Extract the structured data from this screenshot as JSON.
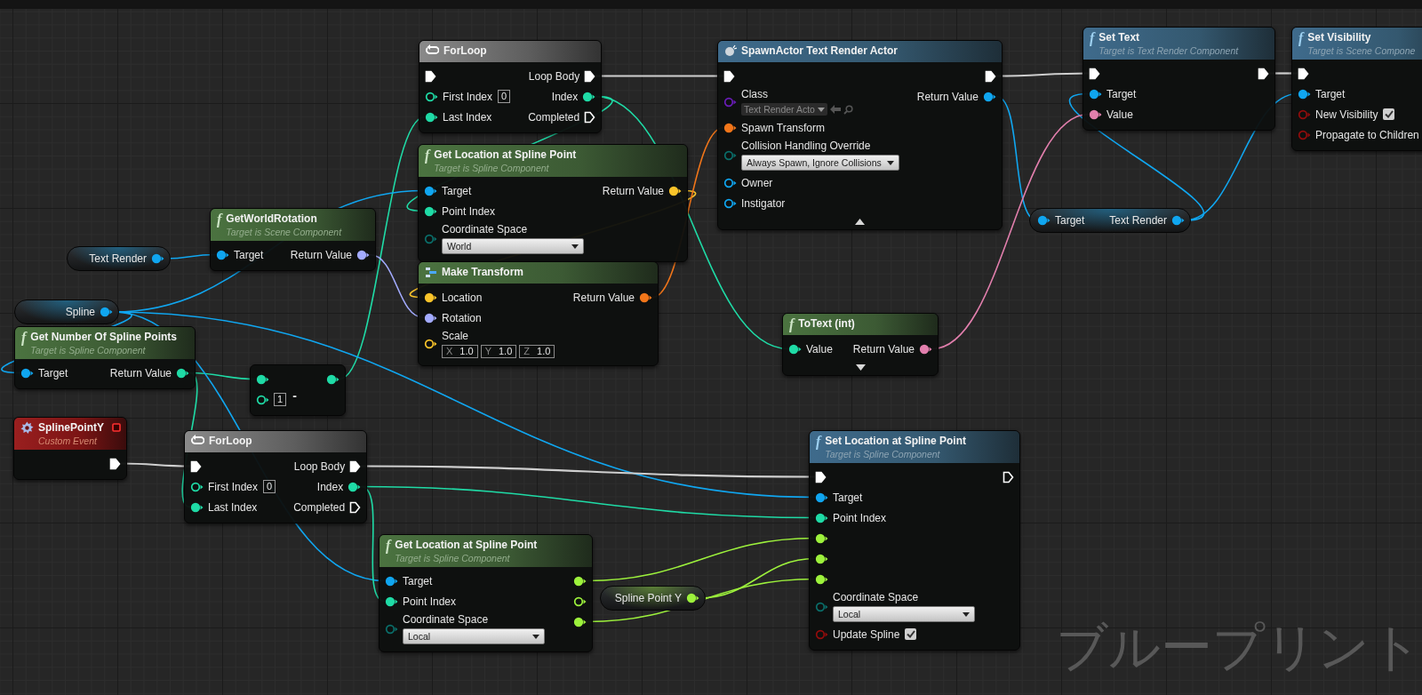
{
  "graph": {
    "nodes": [
      {
        "kind": "macro",
        "title": "ForLoop",
        "inputs": [
          {
            "kind": "exec",
            "color": "#ffffff",
            "connected": true
          },
          {
            "kind": "data",
            "color": "#1fdba6",
            "connected": false,
            "label": "First Index",
            "widget": {
              "kind": "number",
              "value": "0"
            }
          },
          {
            "kind": "data",
            "color": "#1fdba6",
            "connected": true,
            "label": "Last Index"
          }
        ],
        "outputs": [
          {
            "kind": "exec",
            "color": "#ffffff",
            "connected": true,
            "label": "Loop Body"
          },
          {
            "kind": "data",
            "color": "#1fdba6",
            "connected": true,
            "label": "Index"
          },
          {
            "kind": "exec",
            "color": "#ffffff",
            "connected": false,
            "label": "Completed"
          }
        ]
      },
      {
        "kind": "spawn",
        "title": "SpawnActor Text Render Actor",
        "inputs": [
          {
            "kind": "exec",
            "color": "#ffffff",
            "connected": true
          },
          {
            "kind": "data",
            "color": "#6a1cb8",
            "connected": false,
            "label": "Class",
            "widget": {
              "kind": "class_picker",
              "value": "Text Render Acto"
            }
          },
          {
            "kind": "data",
            "color": "#f2761a",
            "connected": true,
            "label": "Spawn Transform"
          },
          {
            "kind": "data",
            "color": "#0a6e6a",
            "connected": false,
            "label": "Collision Handling Override",
            "widget": {
              "kind": "dropdown",
              "value": "Always Spawn, Ignore Collisions"
            }
          },
          {
            "kind": "data",
            "color": "#10a6f0",
            "connected": false,
            "label": "Owner"
          },
          {
            "kind": "data",
            "color": "#10a6f0",
            "connected": false,
            "label": "Instigator"
          }
        ],
        "outputs": [
          {
            "kind": "exec",
            "color": "#ffffff",
            "connected": true
          },
          {
            "kind": "data",
            "color": "#10a6f0",
            "connected": true,
            "label": "Return Value"
          }
        ],
        "advanced_expanded": true
      },
      {
        "kind": "impure",
        "glyph": "f",
        "title": "Set Text",
        "subtitle": "Target is Text Render Component",
        "inputs": [
          {
            "kind": "exec",
            "color": "#ffffff",
            "connected": true
          },
          {
            "kind": "data",
            "color": "#10a6f0",
            "connected": true,
            "label": "Target"
          },
          {
            "kind": "data",
            "color": "#e27fad",
            "connected": true,
            "label": "Value"
          }
        ],
        "outputs": [
          {
            "kind": "exec",
            "color": "#ffffff",
            "connected": true
          }
        ]
      },
      {
        "kind": "impure",
        "glyph": "f",
        "title": "Set Visibility",
        "subtitle": "Target is Scene Compone",
        "inputs": [
          {
            "kind": "exec",
            "color": "#ffffff",
            "connected": true
          },
          {
            "kind": "data",
            "color": "#10a6f0",
            "connected": true,
            "label": "Target"
          },
          {
            "kind": "data",
            "color": "#930c0c",
            "connected": false,
            "label": "New Visibility",
            "widget": {
              "kind": "checkbox",
              "checked": true
            }
          },
          {
            "kind": "data",
            "color": "#930c0c",
            "connected": false,
            "label": "Propagate to Children"
          }
        ]
      },
      {
        "kind": "variable",
        "outputs": [
          {
            "kind": "data",
            "color": "#10a6f0",
            "connected": true,
            "label": "Text Render"
          }
        ]
      },
      {
        "kind": "pure",
        "glyph": "f",
        "title": "GetWorldRotation",
        "subtitle": "Target is Scene Component",
        "inputs": [
          {
            "kind": "data",
            "color": "#10a6f0",
            "connected": true,
            "label": "Target"
          }
        ],
        "outputs": [
          {
            "kind": "data",
            "color": "#a3abff",
            "connected": true,
            "label": "Return Value"
          }
        ]
      },
      {
        "kind": "pure",
        "glyph": "f",
        "title": "Get Location at Spline Point",
        "subtitle": "Target is Spline Component",
        "inputs": [
          {
            "kind": "data",
            "color": "#10a6f0",
            "connected": true,
            "label": "Target"
          },
          {
            "kind": "data",
            "color": "#1fdba6",
            "connected": true,
            "label": "Point Index"
          },
          {
            "kind": "data",
            "color": "#0a6e6a",
            "connected": false,
            "label": "Coordinate Space",
            "widget": {
              "kind": "dropdown",
              "value": "World"
            }
          }
        ],
        "outputs": [
          {
            "kind": "data",
            "color": "#fac42a",
            "connected": true,
            "label": "Return Value"
          }
        ]
      },
      {
        "kind": "variable",
        "outputs": [
          {
            "kind": "data",
            "color": "#10a6f0",
            "connected": true,
            "label": "Spline"
          }
        ]
      },
      {
        "kind": "struct",
        "title": "Make Transform",
        "inputs": [
          {
            "kind": "data",
            "color": "#fac42a",
            "connected": true,
            "label": "Location"
          },
          {
            "kind": "data",
            "color": "#a3abff",
            "connected": true,
            "label": "Rotation"
          },
          {
            "kind": "data",
            "color": "#fac42a",
            "connected": false,
            "label": "Scale",
            "widget": {
              "kind": "vector",
              "components": [
                {
                  "axis": "X",
                  "value": "1.0"
                },
                {
                  "axis": "Y",
                  "value": "1.0"
                },
                {
                  "axis": "Z",
                  "value": "1.0"
                }
              ]
            }
          }
        ],
        "outputs": [
          {
            "kind": "data",
            "color": "#f2761a",
            "connected": true,
            "label": "Return Value"
          }
        ]
      },
      {
        "kind": "pure",
        "glyph": "f",
        "title": "Get Number Of Spline Points",
        "subtitle": "Target is Spline Component",
        "inputs": [
          {
            "kind": "data",
            "color": "#10a6f0",
            "connected": true,
            "label": "Target"
          }
        ],
        "outputs": [
          {
            "kind": "data",
            "color": "#1fdba6",
            "connected": true,
            "label": "Return Value"
          }
        ]
      },
      {
        "kind": "operator",
        "title": "-",
        "inputs": [
          {
            "kind": "data",
            "color": "#1fdba6",
            "connected": true
          },
          {
            "kind": "data",
            "color": "#1fdba6",
            "connected": false,
            "widget": {
              "kind": "number",
              "value": "1"
            }
          }
        ],
        "outputs": [
          {
            "kind": "data",
            "color": "#1fdba6",
            "connected": true
          }
        ]
      },
      {
        "kind": "event",
        "title": "SplinePointY",
        "subtitle": "Custom Event",
        "outputs": [
          {
            "kind": "exec",
            "color": "#ffffff",
            "connected": true
          }
        ]
      },
      {
        "kind": "macro",
        "title": "ForLoop",
        "inputs": [
          {
            "kind": "exec",
            "color": "#ffffff",
            "connected": true
          },
          {
            "kind": "data",
            "color": "#1fdba6",
            "connected": false,
            "label": "First Index",
            "widget": {
              "kind": "number",
              "value": "0"
            }
          },
          {
            "kind": "data",
            "color": "#1fdba6",
            "connected": true,
            "label": "Last Index"
          }
        ],
        "outputs": [
          {
            "kind": "exec",
            "color": "#ffffff",
            "connected": true,
            "label": "Loop Body"
          },
          {
            "kind": "data",
            "color": "#1fdba6",
            "connected": true,
            "label": "Index"
          },
          {
            "kind": "exec",
            "color": "#ffffff",
            "connected": false,
            "label": "Completed"
          }
        ]
      },
      {
        "kind": "pure",
        "glyph": "f",
        "title": "Get Location at Spline Point",
        "subtitle": "Target is Spline Component",
        "inputs": [
          {
            "kind": "data",
            "color": "#10a6f0",
            "connected": true,
            "label": "Target"
          },
          {
            "kind": "data",
            "color": "#1fdba6",
            "connected": true,
            "label": "Point Index"
          },
          {
            "kind": "data",
            "color": "#0a6e6a",
            "connected": false,
            "label": "Coordinate Space",
            "widget": {
              "kind": "dropdown",
              "value": "Local"
            }
          }
        ],
        "outputs": [
          {
            "kind": "data",
            "color": "#9df23c",
            "connected": true
          },
          {
            "kind": "data",
            "color": "#9df23c",
            "connected": false
          },
          {
            "kind": "data",
            "color": "#9df23c",
            "connected": true
          }
        ]
      },
      {
        "kind": "variable",
        "outputs": [
          {
            "kind": "data",
            "color": "#9df23c",
            "connected": true,
            "label": "Spline Point Y"
          }
        ]
      },
      {
        "kind": "pure",
        "glyph": "f",
        "title": "ToText (int)",
        "inputs": [
          {
            "kind": "data",
            "color": "#1fdba6",
            "connected": true,
            "label": "Value"
          }
        ],
        "outputs": [
          {
            "kind": "data",
            "color": "#e27fad",
            "connected": true,
            "label": "Return Value"
          }
        ],
        "advanced_expanded": false
      },
      {
        "kind": "variable",
        "inputs": [
          {
            "kind": "data",
            "color": "#10a6f0",
            "connected": true,
            "label": "Target"
          }
        ],
        "outputs": [
          {
            "kind": "data",
            "color": "#10a6f0",
            "connected": true,
            "label": "Text Render"
          }
        ]
      },
      {
        "kind": "impure",
        "glyph": "f",
        "title": "Set Location at Spline Point",
        "subtitle": "Target is Spline Component",
        "inputs": [
          {
            "kind": "exec",
            "color": "#ffffff",
            "connected": true
          },
          {
            "kind": "data",
            "color": "#10a6f0",
            "connected": true,
            "label": "Target"
          },
          {
            "kind": "data",
            "color": "#1fdba6",
            "connected": true,
            "label": "Point Index"
          },
          {
            "kind": "data",
            "color": "#9df23c",
            "connected": true
          },
          {
            "kind": "data",
            "color": "#9df23c",
            "connected": true
          },
          {
            "kind": "data",
            "color": "#9df23c",
            "connected": true
          },
          {
            "kind": "data",
            "color": "#0a6e6a",
            "connected": false,
            "label": "Coordinate Space",
            "widget": {
              "kind": "dropdown",
              "value": "Local"
            }
          },
          {
            "kind": "data",
            "color": "#930c0c",
            "connected": false,
            "label": "Update Spline",
            "widget": {
              "kind": "checkbox",
              "checked": true
            }
          }
        ],
        "outputs": [
          {
            "kind": "exec",
            "color": "#ffffff",
            "connected": false
          }
        ]
      }
    ],
    "graph_label": "ブループリント"
  }
}
